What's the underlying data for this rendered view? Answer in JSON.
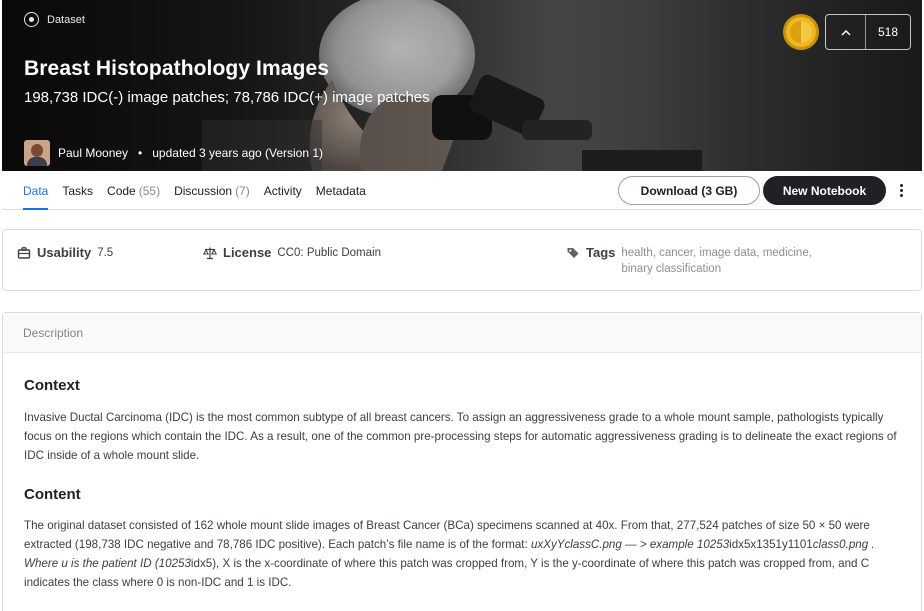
{
  "hero": {
    "type_label": "Dataset",
    "title": "Breast Histopathology Images",
    "subtitle": "198,738 IDC(-) image patches; 78,786 IDC(+) image patches",
    "author": "Paul Mooney",
    "separator": "•",
    "updated": "updated 3 years ago (Version 1)",
    "vote_icon": "chevron-up-icon",
    "vote_count": "518",
    "medal_color": "#f0b81c"
  },
  "tabs": [
    {
      "label": "Data",
      "count": "",
      "active": true
    },
    {
      "label": "Tasks",
      "count": "",
      "active": false
    },
    {
      "label": "Code",
      "count": "(55)",
      "active": false
    },
    {
      "label": "Discussion",
      "count": "(7)",
      "active": false
    },
    {
      "label": "Activity",
      "count": "",
      "active": false
    },
    {
      "label": "Metadata",
      "count": "",
      "active": false
    }
  ],
  "actions": {
    "download_label": "Download (3 GB)",
    "new_notebook_label": "New Notebook"
  },
  "meta": {
    "usability_label": "Usability",
    "usability_value": "7.5",
    "license_label": "License",
    "license_value": "CC0: Public Domain",
    "tags_label": "Tags",
    "tags": [
      "health",
      "cancer",
      "image data",
      "medicine",
      "binary classification"
    ]
  },
  "description": {
    "header": "Description",
    "context_heading": "Context",
    "context_text": "Invasive Ductal Carcinoma (IDC) is the most common subtype of all breast cancers. To assign an aggressiveness grade to a whole mount sample, pathologists typically focus on the regions which contain the IDC. As a result, one of the common pre-processing steps for automatic aggressiveness grading is to delineate the exact regions of IDC inside of a whole mount slide.",
    "content_heading": "Content",
    "content_p1": "The original dataset consisted of 162 whole mount slide images of Breast Cancer (BCa) specimens scanned at 40x. From that, 277,524 patches of size 50 × 50 were extracted (198,738 IDC negative and 78,786 IDC positive). Each patch’s file name is of the format: ",
    "content_fmt": "uxXyYclassC.png — > example 10253",
    "content_p2": "idx5x1351y1101",
    "content_fmt2": "class0.png . Where u is the patient ID (10253",
    "content_p3": "idx5), X is the x-coordinate of where this patch was cropped from, Y is the y-coordinate of where this patch was cropped from, and C indicates the class where 0 is non-IDC and 1 is IDC."
  },
  "colors": {
    "accent": "#1a73e8",
    "dark_button": "#202124"
  }
}
